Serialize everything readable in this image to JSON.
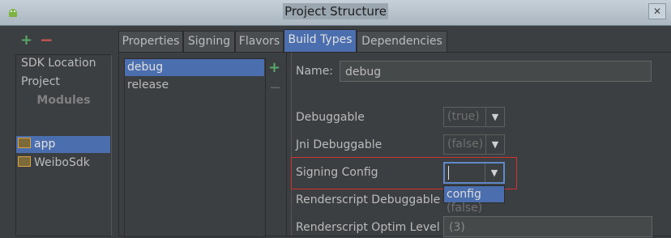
{
  "window": {
    "title": "Project Structure",
    "close_label": "✕"
  },
  "left_pane": {
    "add_label": "+",
    "remove_label": "−",
    "items": [
      "SDK Location",
      "Project"
    ],
    "section_label": "Modules",
    "modules": [
      "app",
      "WeiboSdk"
    ],
    "selected_module": "app"
  },
  "tabs": [
    "Properties",
    "Signing",
    "Flavors",
    "Build Types",
    "Dependencies"
  ],
  "active_tab": "Build Types",
  "build_types": {
    "items": [
      "debug",
      "release"
    ],
    "selected": "debug",
    "add_label": "+",
    "remove_label": "−"
  },
  "form": {
    "name_label": "Name:",
    "name_value": "debug",
    "debuggable_label": "Debuggable",
    "debuggable_value": "(true)",
    "jni_label": "Jni Debuggable",
    "jni_value": "(false)",
    "signing_label": "Signing Config",
    "signing_value": "",
    "signing_option": "config",
    "renderscript_label": "Renderscript Debuggable",
    "renderscript_value": "(false)",
    "optim_label": "Renderscript Optim Level",
    "optim_value": "(3)"
  },
  "colors": {
    "selection": "#4b6eaf",
    "highlight_box": "#d0322f",
    "add": "#59a869",
    "remove": "#c75450"
  }
}
